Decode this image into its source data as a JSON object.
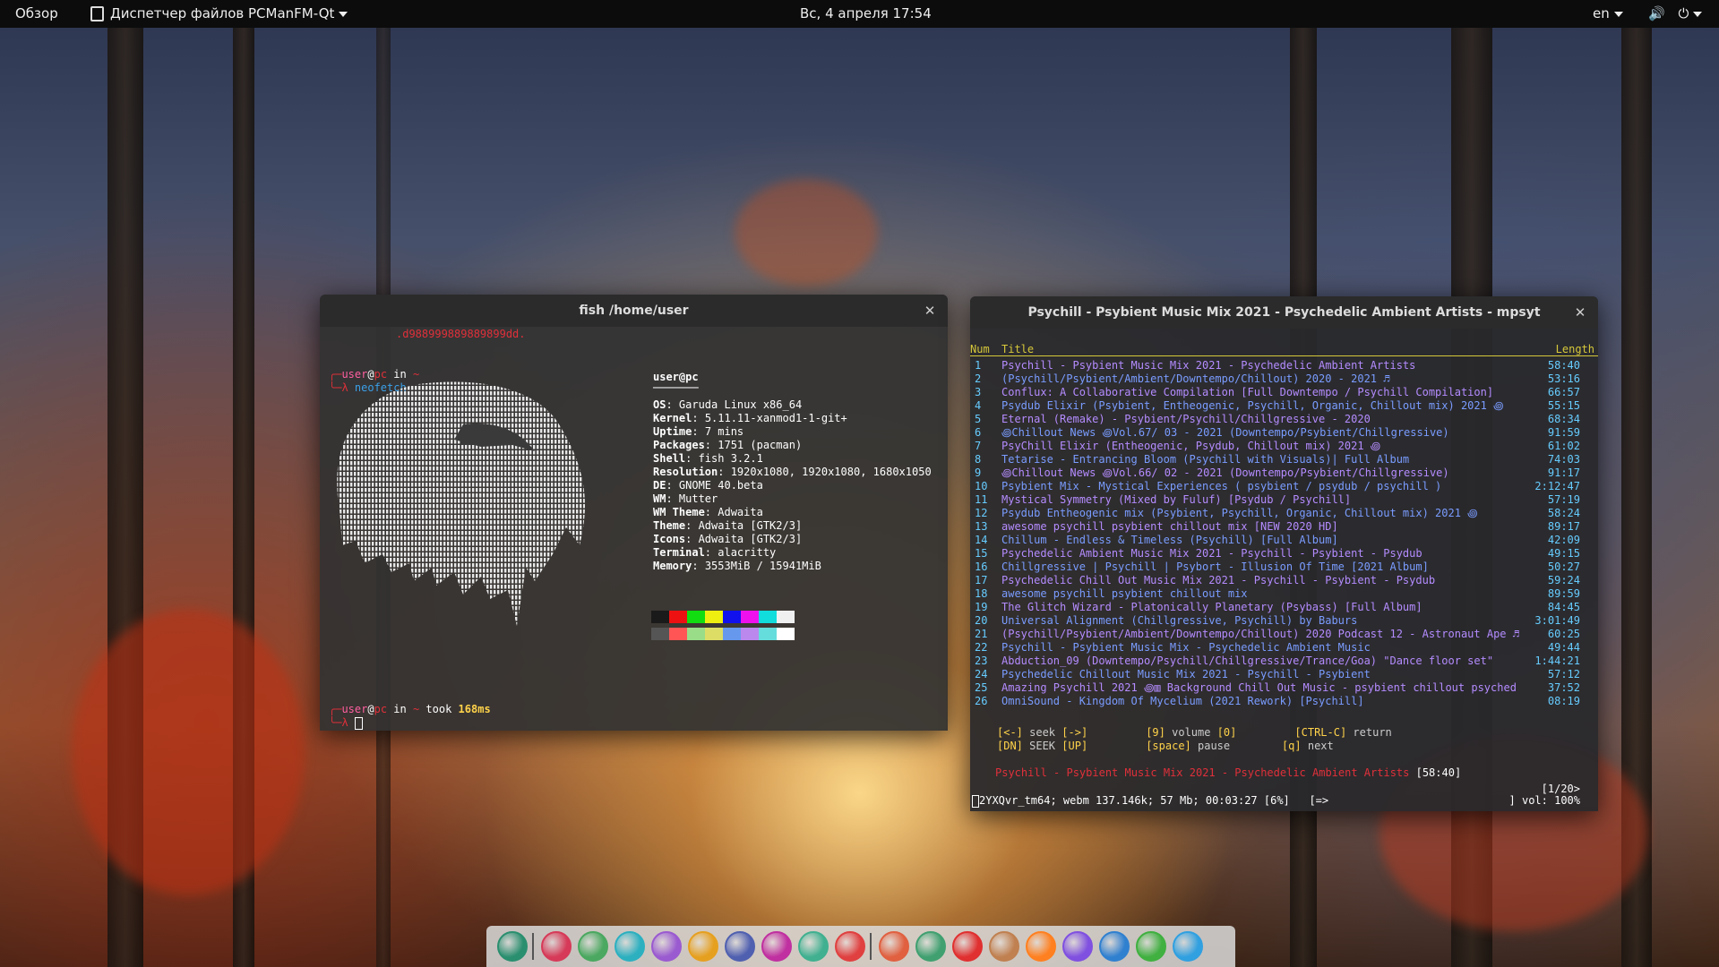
{
  "topbar": {
    "overview": "Обзор",
    "app_menu": "Диспетчер файлов PCManFM-Qt",
    "clock": "Вс, 4 апреля  17:54",
    "lang": "en"
  },
  "fish": {
    "title": "fish /home/user",
    "top_line": ".d988999889889899dd.",
    "prompt1_user": "user",
    "prompt1_at": "@",
    "prompt1_host": "pc",
    "prompt1_in": " in ",
    "prompt1_dir": "~",
    "cmd1": "neofetch",
    "prompt2_user": "user",
    "prompt2_at": "@",
    "prompt2_host": "pc",
    "prompt2_in": " in ",
    "prompt2_dir": "~",
    "took_label": " took ",
    "took_value": "168ms",
    "neofetch": {
      "header": "user@pc",
      "lines": [
        {
          "k": "OS",
          "v": "Garuda Linux x86_64"
        },
        {
          "k": "Kernel",
          "v": "5.11.11-xanmod1-1-git+"
        },
        {
          "k": "Uptime",
          "v": "7 mins"
        },
        {
          "k": "Packages",
          "v": "1751 (pacman)"
        },
        {
          "k": "Shell",
          "v": "fish 3.2.1"
        },
        {
          "k": "Resolution",
          "v": "1920x1080, 1920x1080, 1680x1050"
        },
        {
          "k": "DE",
          "v": "GNOME 40.beta"
        },
        {
          "k": "WM",
          "v": "Mutter"
        },
        {
          "k": "WM Theme",
          "v": "Adwaita"
        },
        {
          "k": "Theme",
          "v": "Adwaita [GTK2/3]"
        },
        {
          "k": "Icons",
          "v": "Adwaita [GTK2/3]"
        },
        {
          "k": "Terminal",
          "v": "alacritty"
        },
        {
          "k": "Memory",
          "v": "3553MiB / 15941MiB"
        }
      ],
      "swatch_colors_top": [
        "#1a1a1a",
        "#ee1111",
        "#11dd11",
        "#eeee11",
        "#1111ee",
        "#ee11ee",
        "#11dddd",
        "#f0f0f0"
      ],
      "swatch_colors_bottom": [
        "#555555",
        "#ff5555",
        "#99dd88",
        "#dddd66",
        "#6699ee",
        "#bb88ee",
        "#66dddd",
        "#ffffff"
      ]
    }
  },
  "mpsyt": {
    "title": "Psychill - Psybient Music Mix 2021 - Psychedelic Ambient Artists - mpsyt",
    "col_num": "Num",
    "col_title": "Title",
    "col_length": "Length",
    "rows": [
      {
        "n": "1",
        "t": "Psychill - Psybient Music Mix 2021 - Psychedelic Ambient Artists",
        "l": "58:40"
      },
      {
        "n": "2",
        "t": "(Psychill/Psybient/Ambient/Downtempo/Chillout) 2020 - 2021 ♬",
        "l": "53:16"
      },
      {
        "n": "3",
        "t": "Conflux: A Collaborative Compilation  [Full Downtempo / Psychill Compilation]",
        "l": "66:57"
      },
      {
        "n": "4",
        "t": "Psydub Elixir (Psybient, Entheogenic, Psychill, Organic, Chillout mix) 2021 ꩜",
        "l": "55:15"
      },
      {
        "n": "5",
        "t": "Eternal (Remake) - Psybient/Psychill/Chillgressive - 2020",
        "l": "68:34"
      },
      {
        "n": "6",
        "t": "꩜Chillout News ꩜Vol.67/ 03 - 2021 (Downtempo/Psybient/Chillgressive)",
        "l": "91:59"
      },
      {
        "n": "7",
        "t": "PsyChill Elixir (Entheogenic, Psydub, Chillout mix) 2021 ꩜",
        "l": "61:02"
      },
      {
        "n": "8",
        "t": "Tetarise - Entrancing Bloom (Psychill with Visuals)| Full Album",
        "l": "74:03"
      },
      {
        "n": "9",
        "t": "꩜Chillout News ꩜Vol.66/ 02 - 2021 (Downtempo/Psybient/Chillgressive)",
        "l": "91:17"
      },
      {
        "n": "10",
        "t": "Psybient Mix - Mystical Experiences ( psybient / psydub / psychill )",
        "l": "2:12:47"
      },
      {
        "n": "11",
        "t": "Mystical Symmetry (Mixed by Fuluf) [Psydub / Psychill]",
        "l": "57:19"
      },
      {
        "n": "12",
        "t": "Psydub Entheogenic mix (Psybient, Psychill, Organic, Chillout mix) 2021 ꩜",
        "l": "58:24"
      },
      {
        "n": "13",
        "t": "awesome psychill psybient chillout mix [NEW 2020 HD]",
        "l": "89:17"
      },
      {
        "n": "14",
        "t": "Chillum - Endless & Timeless (Psychill) [Full Album]",
        "l": "42:09"
      },
      {
        "n": "15",
        "t": "Psychedelic Ambient Music Mix 2021 - Psychill - Psybient - Psydub",
        "l": "49:15"
      },
      {
        "n": "16",
        "t": "Chillgressive | Psychill | Psybort - Illusion Of Time [2021 Album]",
        "l": "50:27"
      },
      {
        "n": "17",
        "t": "Psychedelic Chill Out Music Mix 2021 - Psychill - Psybient - Psydub",
        "l": "59:24"
      },
      {
        "n": "18",
        "t": "awesome psychill psybient chillout mix",
        "l": "89:59"
      },
      {
        "n": "19",
        "t": "The Glitch Wizard - Platonically Planetary (Psybass) [Full Album]",
        "l": "84:45"
      },
      {
        "n": "20",
        "t": "Universal Alignment (Chillgressive, Psychill) by Baburs",
        "l": "3:01:49"
      },
      {
        "n": "21",
        "t": "(Psychill/Psybient/Ambient/Downtempo/Chillout) 2020 Podcast 12 - Astronaut Ape ♬",
        "l": "60:25"
      },
      {
        "n": "22",
        "t": "Psychill - Psybient Music Mix - Psychedelic Ambient Music",
        "l": "49:44"
      },
      {
        "n": "23",
        "t": "Abduction_09 (Downtempo/Psychill/Chillgressive/Trance/Goa) \"Dance floor set\"",
        "l": "1:44:21"
      },
      {
        "n": "24",
        "t": "Psychedelic Chillout Music Mix 2021 - Psychill - Psybient",
        "l": "57:12"
      },
      {
        "n": "25",
        "t": "Amazing Psychill 2021 ꩜▥ Background Chill Out Music - psybient chillout psyched",
        "l": "37:52"
      },
      {
        "n": "26",
        "t": "OmniSound - Kingdom Of Mycelium (2021 Rework) [Psychill]",
        "l": "08:19"
      }
    ],
    "keys": {
      "seek_l": "[<-]",
      "seek": " seek ",
      "seek_r": "[->]",
      "vol_l": "[9]",
      "volume": " volume ",
      "vol_r": "[0]",
      "ret_k": "[CTRL-C]",
      "ret": " return",
      "dn": "[DN]",
      "seek2": " SEEK ",
      "up": "[UP]",
      "space": "[space]",
      "pause": " pause",
      "q": "[q]",
      "next": " next"
    },
    "now_playing": "Psychill - Psybient Music Mix 2021 - Psychedelic Ambient Artists",
    "now_playing_len": "[58:40]",
    "page_indicator": "[1/20>",
    "status": "2YXQvr_tm64; webm 137.146k; 57 Mb; 00:03:27 [6%]   [=>",
    "volume": "] vol: 100%"
  },
  "dock": {
    "icons": [
      "garuda-icon",
      "terminal-icon",
      "system-monitor-icon",
      "gauge-icon",
      "settings-gear-icon",
      "tasks-icon",
      "image-viewer-icon",
      "media-player-icon",
      "software-store-icon",
      "power-icon",
      "network-icon",
      "remote-desktop-icon",
      "control-center-icon",
      "archive-icon",
      "firefox-icon",
      "discord-icon",
      "fan-icon",
      "chrome-icon",
      "telegram-icon"
    ],
    "colors": [
      "#2a8f6f",
      "#d63a58",
      "#4aa860",
      "#2cb0c0",
      "#9a5ad0",
      "#e6a020",
      "#5060b0",
      "#c030a0",
      "#40b090",
      "#e04040",
      "#e06040",
      "#40a070",
      "#e03030",
      "#c08050",
      "#ff8020",
      "#8050e0",
      "#3080d0",
      "#40b040",
      "#30a0e0"
    ]
  }
}
